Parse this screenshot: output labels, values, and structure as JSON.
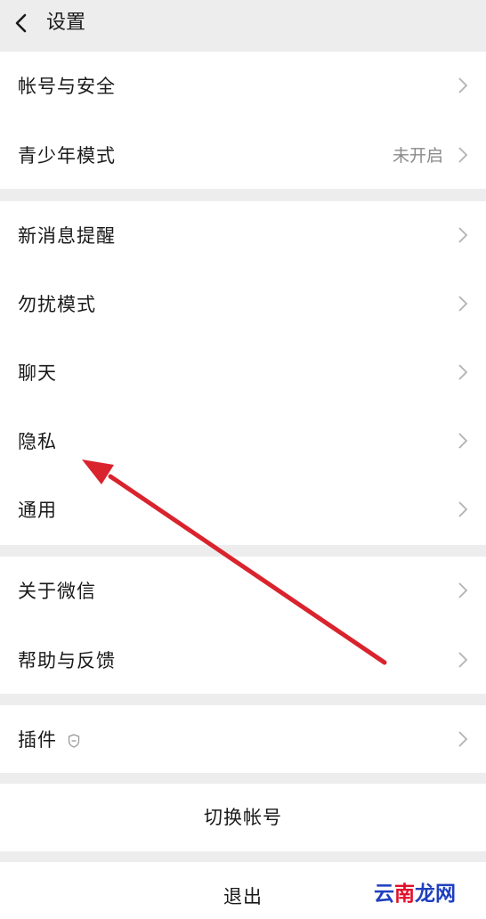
{
  "header": {
    "title": "设置",
    "back_icon": "chevron-left-icon"
  },
  "groups": [
    {
      "items": [
        {
          "label": "帐号与安全",
          "value": ""
        },
        {
          "label": "青少年模式",
          "value": "未开启"
        }
      ]
    },
    {
      "items": [
        {
          "label": "新消息提醒",
          "value": ""
        },
        {
          "label": "勿扰模式",
          "value": ""
        },
        {
          "label": "聊天",
          "value": ""
        },
        {
          "label": "隐私",
          "value": ""
        },
        {
          "label": "通用",
          "value": ""
        }
      ]
    },
    {
      "items": [
        {
          "label": "关于微信",
          "value": ""
        },
        {
          "label": "帮助与反馈",
          "value": ""
        }
      ]
    },
    {
      "items": [
        {
          "label": "插件",
          "value": "",
          "badge_icon": "shield-icon"
        }
      ]
    }
  ],
  "actions": {
    "switch_account": "切换帐号",
    "logout": "退出"
  },
  "watermark": {
    "part1": "云",
    "part2": "南",
    "part3": "龙网"
  },
  "annotation": {
    "type": "red-arrow",
    "color": "#d9232d",
    "points_to": "隐私"
  },
  "colors": {
    "background": "#ededed",
    "card": "#ffffff",
    "text": "#1a1a1a",
    "secondary_text": "#8a8a8a",
    "chevron": "#b2b2b2"
  }
}
